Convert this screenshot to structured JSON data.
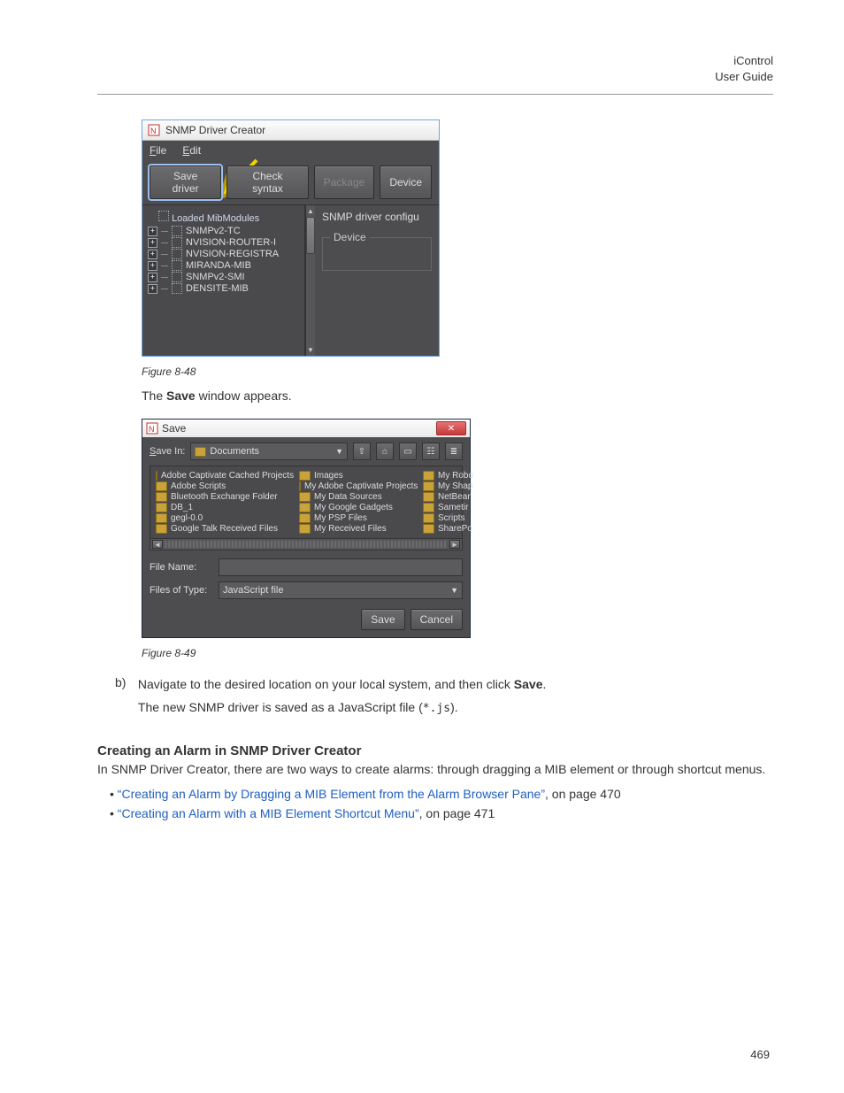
{
  "header": {
    "title": "iControl",
    "subtitle": "User Guide"
  },
  "fig48": {
    "caption": "Figure 8-48",
    "window_title": "SNMP Driver Creator",
    "menu": {
      "file": "File",
      "edit": "Edit"
    },
    "toolbar": {
      "save_driver": "Save driver",
      "check_syntax": "Check syntax",
      "package": "Package",
      "device": "Device"
    },
    "tree": {
      "heading": "Loaded MibModules",
      "items": [
        "SNMPv2-TC",
        "NVISION-ROUTER-I",
        "NVISION-REGISTRA",
        "MIRANDA-MIB",
        "SNMPv2-SMI",
        "DENSITE-MIB"
      ]
    },
    "right": {
      "heading": "SNMP driver configu",
      "group": "Device"
    }
  },
  "mid_text": {
    "pre": "The ",
    "bold": "Save",
    "post": " window appears."
  },
  "fig49": {
    "caption": "Figure 8-49",
    "window_title": "Save",
    "save_in_label": "Save In:",
    "save_in_value": "Documents",
    "icon_buttons": [
      "up-one-level-icon",
      "home-icon",
      "new-folder-icon",
      "list-view-icon",
      "details-view-icon"
    ],
    "columns": [
      [
        "Adobe Captivate Cached Projects",
        "Adobe Scripts",
        "Bluetooth Exchange Folder",
        "DB_1",
        "gegl-0.0",
        "Google Talk Received Files"
      ],
      [
        "Images",
        "My Adobe Captivate Projects",
        "My Data Sources",
        "My Google Gadgets",
        "My PSP Files",
        "My Received Files"
      ],
      [
        "My Robo",
        "My Shap",
        "NetBear",
        "Sametir",
        "Scripts",
        "SharePo"
      ]
    ],
    "file_name_label": "File Name:",
    "file_name_value": "",
    "files_of_type_label": "Files of Type:",
    "files_of_type_value": "JavaScript file",
    "save_btn": "Save",
    "cancel_btn": "Cancel"
  },
  "step_b": {
    "label": "b)",
    "line1_pre": "Navigate to the desired location on your local system, and then click ",
    "line1_bold": "Save",
    "line1_post": ".",
    "line2_pre": "The new SNMP driver is saved as a JavaScript file (",
    "line2_code": "*.js",
    "line2_post": ")."
  },
  "subhead": "Creating an Alarm in SNMP Driver Creator",
  "subpara": "In SNMP Driver Creator, there are two ways to create alarms: through dragging a MIB element or through shortcut menus.",
  "links": [
    {
      "text": "Creating an Alarm by Dragging a MIB Element from the Alarm Browser Pane",
      "suffix": ", on page 470"
    },
    {
      "text": "Creating an Alarm with a MIB Element Shortcut Menu",
      "suffix": ", on page 471"
    }
  ],
  "page_number": "469"
}
